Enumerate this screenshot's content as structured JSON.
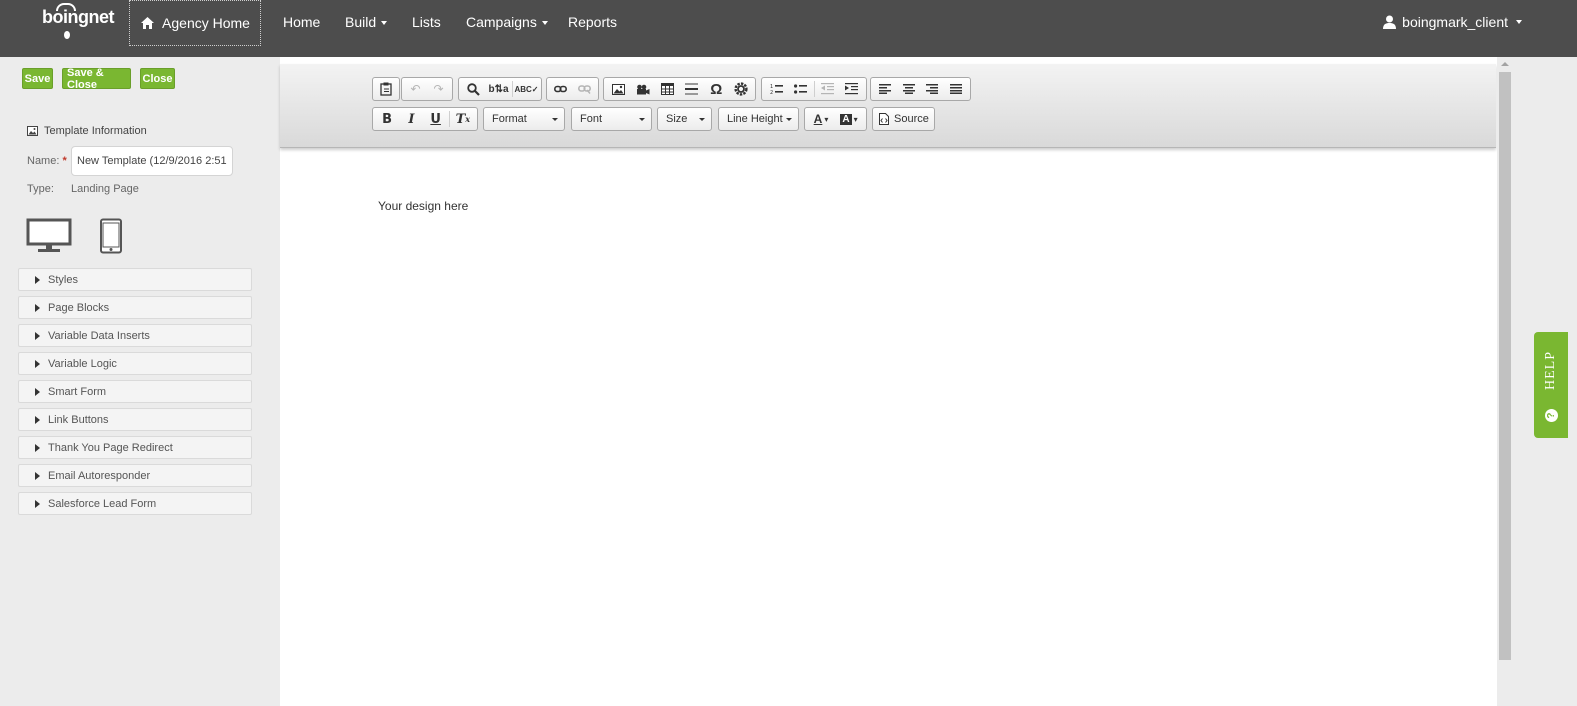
{
  "nav": {
    "logo": "boingnet",
    "agency_home": "Agency Home",
    "items": [
      "Home",
      "Build",
      "Lists",
      "Campaigns",
      "Reports"
    ],
    "user": "boingmark_client"
  },
  "actions": {
    "save": "Save",
    "save_close": "Save & Close",
    "close": "Close"
  },
  "template": {
    "heading": "Template Information",
    "name_label": "Name:",
    "name_value": "New Template (12/9/2016 2:51",
    "type_label": "Type:",
    "type_value": "Landing Page"
  },
  "sections": [
    "Styles",
    "Page Blocks",
    "Variable Data Inserts",
    "Variable Logic",
    "Smart Form",
    "Link Buttons",
    "Thank You Page Redirect",
    "Email Autoresponder",
    "Salesforce Lead Form"
  ],
  "toolbar": {
    "format": "Format",
    "font": "Font",
    "size": "Size",
    "line_height": "Line Height",
    "source": "Source"
  },
  "editor": {
    "placeholder": "Your design here"
  },
  "help": {
    "label": "HELP"
  }
}
